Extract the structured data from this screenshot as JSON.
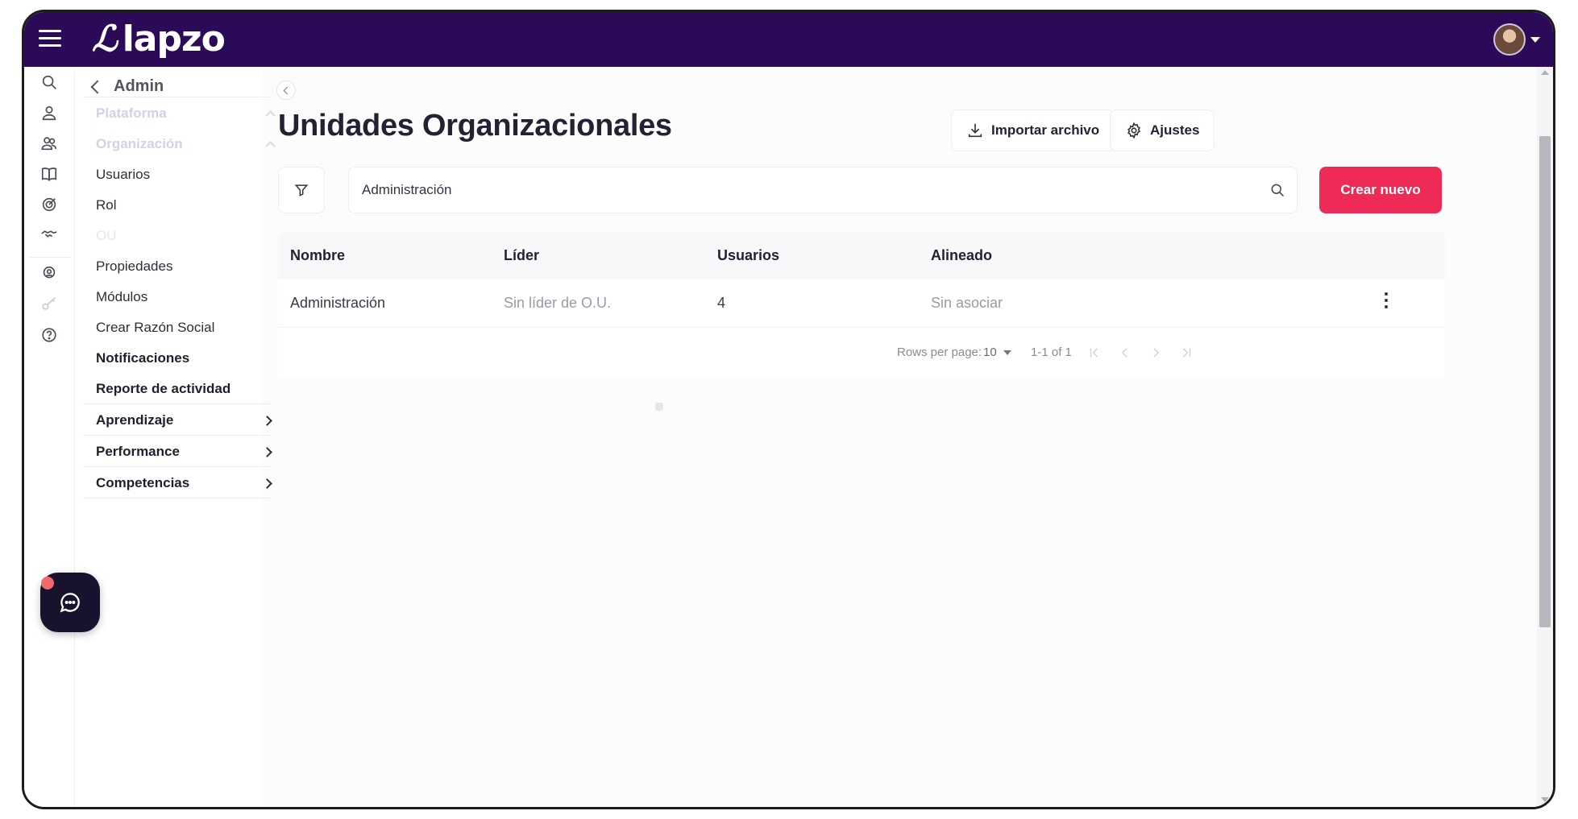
{
  "app": {
    "logo_mark": "ℒ",
    "logo_text": "lapzo"
  },
  "sidebar": {
    "back_label": "Admin",
    "sections": [
      {
        "label": "Plataforma"
      },
      {
        "label": "Organización"
      }
    ],
    "items": [
      {
        "label": "Usuarios"
      },
      {
        "label": "Rol"
      },
      {
        "label": "OU"
      },
      {
        "label": "Propiedades"
      },
      {
        "label": "Módulos"
      },
      {
        "label": "Crear Razón Social"
      },
      {
        "label": "Notificaciones"
      },
      {
        "label": "Reporte de actividad"
      }
    ],
    "groups": [
      {
        "label": "Aprendizaje"
      },
      {
        "label": "Performance"
      },
      {
        "label": "Competencias"
      }
    ]
  },
  "main": {
    "title": "Unidades Organizacionales",
    "import_label": "Importar archivo",
    "settings_label": "Ajustes",
    "search": {
      "value": "Administración",
      "placeholder": ""
    },
    "create_label": "Crear nuevo"
  },
  "table": {
    "columns": [
      "Nombre",
      "Líder",
      "Usuarios",
      "Alineado"
    ],
    "rows": [
      {
        "nombre": "Administración",
        "lider": "Sin líder de O.U.",
        "usuarios": "4",
        "alineado": "Sin asociar"
      }
    ],
    "pagination": {
      "rows_per_page_label": "Rows per page:",
      "rows_per_page": "10",
      "range": "1-1 of 1"
    }
  },
  "colors": {
    "topbar": "#2b0a57",
    "primary": "#ee2a56",
    "chat": "#18122e"
  },
  "icons": [
    "menu-icon",
    "search-icon",
    "user-icon",
    "users-icon",
    "book-icon",
    "target-icon",
    "handshake-icon",
    "badge-icon",
    "key-icon",
    "help-icon",
    "download-icon",
    "gear-icon",
    "filter-icon",
    "chat-icon"
  ]
}
